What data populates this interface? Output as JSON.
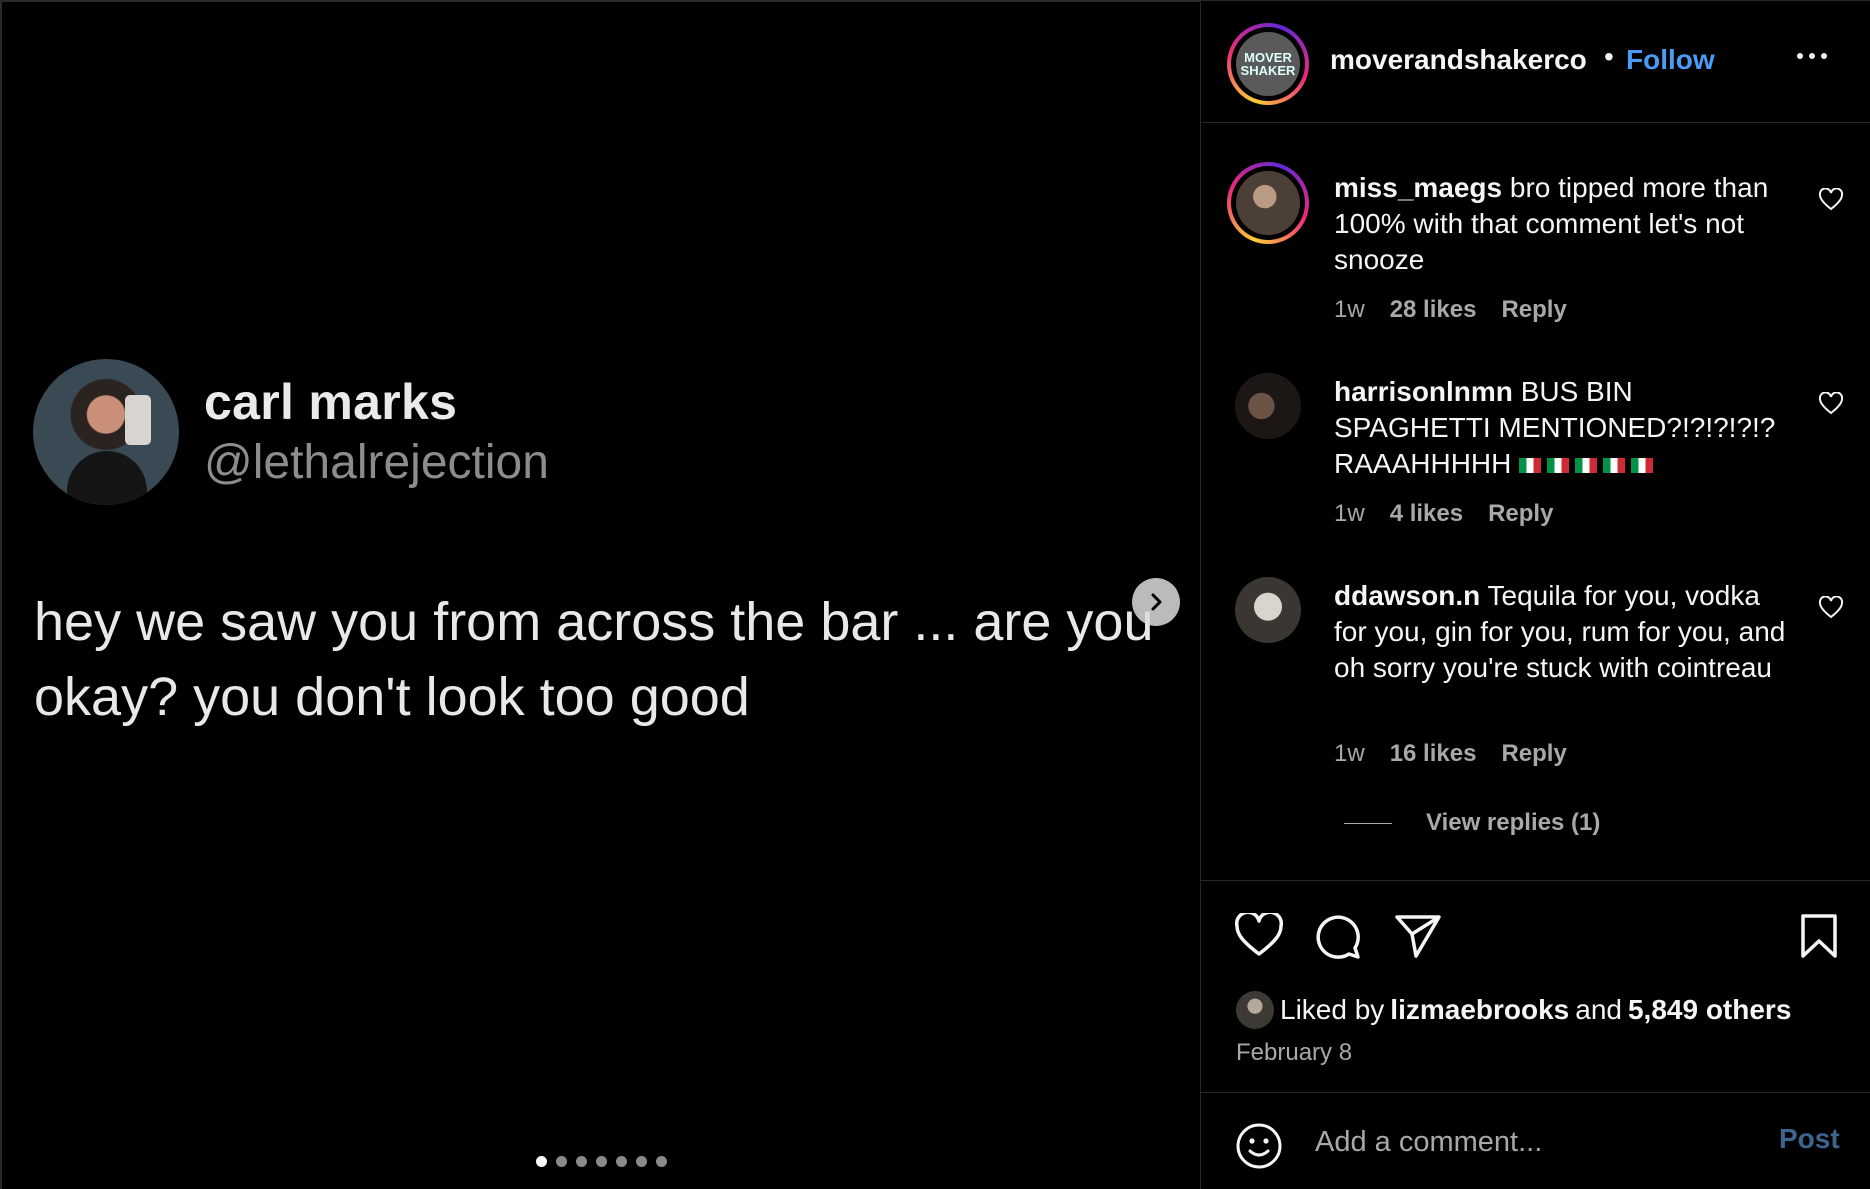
{
  "post": {
    "tweet": {
      "display_name": "carl marks",
      "handle": "@lethalrejection",
      "text": "hey we saw you from across the bar ... are you okay? you don't look too good"
    },
    "carousel": {
      "total": 7,
      "active_index": 0
    }
  },
  "header": {
    "username": "moverandshakerco",
    "separator": "•",
    "follow_label": "Follow",
    "logo_text": "MOVER SHAKER"
  },
  "comments": [
    {
      "username": "miss_maegs",
      "text": "bro tipped more than 100% with that comment let's not snooze",
      "time": "1w",
      "likes": "28 likes",
      "reply_label": "Reply"
    },
    {
      "username": "harrisonlnmn",
      "text": "BUS BIN SPAGHETTI MENTIONED?!?!?!?!? RAAAHHHHH",
      "flag_icon": "italy-flag-icon",
      "flag_count": 5,
      "time": "1w",
      "likes": "4 likes",
      "reply_label": "Reply"
    },
    {
      "username": "ddawson.n",
      "text": "Tequila for you, vodka for you, gin for you, rum for you, and oh sorry you're stuck with cointreau",
      "time": "1w",
      "likes": "16 likes",
      "reply_label": "Reply",
      "view_replies": "View replies (1)"
    }
  ],
  "likes_summary": {
    "prefix": "Liked by",
    "user": "lizmaebrooks",
    "conjunction": "and",
    "others": "5,849 others"
  },
  "date": "February 8",
  "comment_input": {
    "placeholder": "Add a comment...",
    "post_label": "Post"
  },
  "colors": {
    "follow": "#4a9bf5",
    "muted": "#a8a8a8",
    "post_disabled": "#3d6590"
  }
}
